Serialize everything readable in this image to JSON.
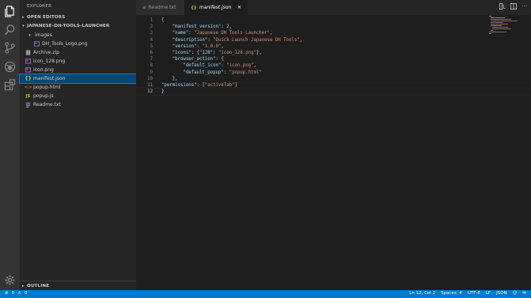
{
  "colors": {
    "activity_bar": "#333333",
    "sidebar": "#252526",
    "editor": "#1e1e1e",
    "status_bar": "#007acc",
    "selection": "#094771",
    "string": "#ce9178",
    "key": "#9cdcfe"
  },
  "activity_bar": {
    "icons": [
      "files-icon",
      "search-icon",
      "source-control-icon",
      "debug-icon",
      "extensions-icon",
      "settings-gear-icon"
    ]
  },
  "sidebar": {
    "title": "EXPLORER",
    "open_editors_label": "OPEN EDITORS",
    "folder_label": "JAPANESE-DH-TOOLS-LAUNCHER",
    "outline_label": "OUTLINE",
    "files": [
      {
        "name": "images",
        "icon": "folder-open-icon"
      },
      {
        "name": "DH_Tools_Logo.png",
        "icon": "image-icon"
      },
      {
        "name": "Archive.zip",
        "icon": "zip-icon"
      },
      {
        "name": "icon_128.png",
        "icon": "image-icon"
      },
      {
        "name": "icon.png",
        "icon": "image-icon"
      },
      {
        "name": "manifest.json",
        "icon": "json-icon"
      },
      {
        "name": "popup.html",
        "icon": "html-icon"
      },
      {
        "name": "popup.js",
        "icon": "js-icon"
      },
      {
        "name": "Readme.txt",
        "icon": "text-icon"
      }
    ]
  },
  "tabs": [
    {
      "label": "Readme.txt",
      "icon": "text-icon",
      "active": false
    },
    {
      "label": "manifest.json",
      "icon": "json-icon",
      "active": true
    }
  ],
  "editor": {
    "lines": [
      {
        "n": "1",
        "text": "{"
      },
      {
        "n": "2",
        "text": "    \"manifest_version\": 2,"
      },
      {
        "n": "3",
        "text": "    \"name\": \"Japanese DH Tools Launcher\","
      },
      {
        "n": "4",
        "text": "    \"description\": \"Quick Launch Japanese DH Tools\","
      },
      {
        "n": "5",
        "text": "    \"version\": \"1.0.0\","
      },
      {
        "n": "6",
        "text": "    \"icons\": {\"128\": \"icon_128.png\"},"
      },
      {
        "n": "7",
        "text": "    \"browser_action\": {"
      },
      {
        "n": "8",
        "text": "        \"default_icon\": \"icon.png\","
      },
      {
        "n": "9",
        "text": "        \"default_popup\": \"popup.html\""
      },
      {
        "n": "10",
        "text": "    },"
      },
      {
        "n": "11",
        "text": "\"permissions\": [\"activeTab\"]"
      },
      {
        "n": "12",
        "text": "}"
      }
    ]
  },
  "status_bar": {
    "errors": "0",
    "warnings": "0",
    "position": "Ln 12, Col 2",
    "spaces": "Spaces: 4",
    "encoding": "UTF-8",
    "eol": "LF",
    "language": "JSON"
  }
}
